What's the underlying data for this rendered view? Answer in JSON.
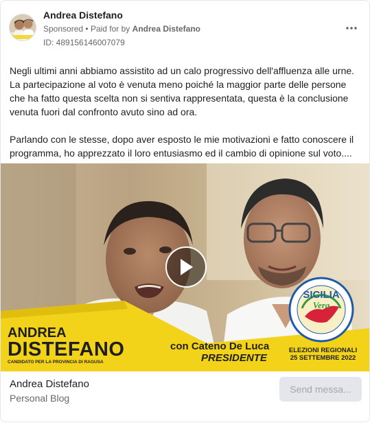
{
  "header": {
    "page_name": "Andrea Distefano",
    "sponsored": "Sponsored",
    "separator": "•",
    "paid_for_by": "Paid for by",
    "payer": "Andrea Distefano",
    "ad_id": "ID: 489156146007079",
    "more_icon": "more-horizontal-icon"
  },
  "post": {
    "paragraph_1": "Negli ultimi anni abbiamo assistito ad un calo progressivo dell'affluenza alle urne. La partecipazione al voto è venuta meno poiché la maggior parte delle persone che ha fatto questa scelta non si sentiva rappresentata, questa è la conclusione venuta fuori dal confronto avuto sino ad ora.",
    "paragraph_2": "Parlando con le stesse, dopo aver esposto le mie motivazioni e fatto conoscere il programma, ho apprezzato il loro entusiasmo ed il cambio di opinione sul voto...."
  },
  "video": {
    "play_icon": "play-icon",
    "banner": {
      "first_name": "ANDREA",
      "last_name": "DISTEFANO",
      "candidate_line": "CANDIDATO PER LA PROVINCIA DI RAGUSA",
      "with_line": "con Cateno De Luca",
      "role": "PRESIDENTE",
      "logo_top": "SICILIA",
      "logo_script": "Vera",
      "logo_ring": "SICILIA VERA ECONOMIA REGIONALE AUTONOMA",
      "election_line_1": "ELEZIONI REGIONALI",
      "election_line_2": "25 SETTEMBRE 2022"
    },
    "colors": {
      "banner_yellow": "#f3d21a",
      "banner_dark": "#1f1f1f",
      "logo_blue": "#1e5aa8",
      "logo_green": "#3a9a3a"
    }
  },
  "footer": {
    "title": "Andrea Distefano",
    "subtitle": "Personal Blog",
    "cta": "Send messa..."
  }
}
